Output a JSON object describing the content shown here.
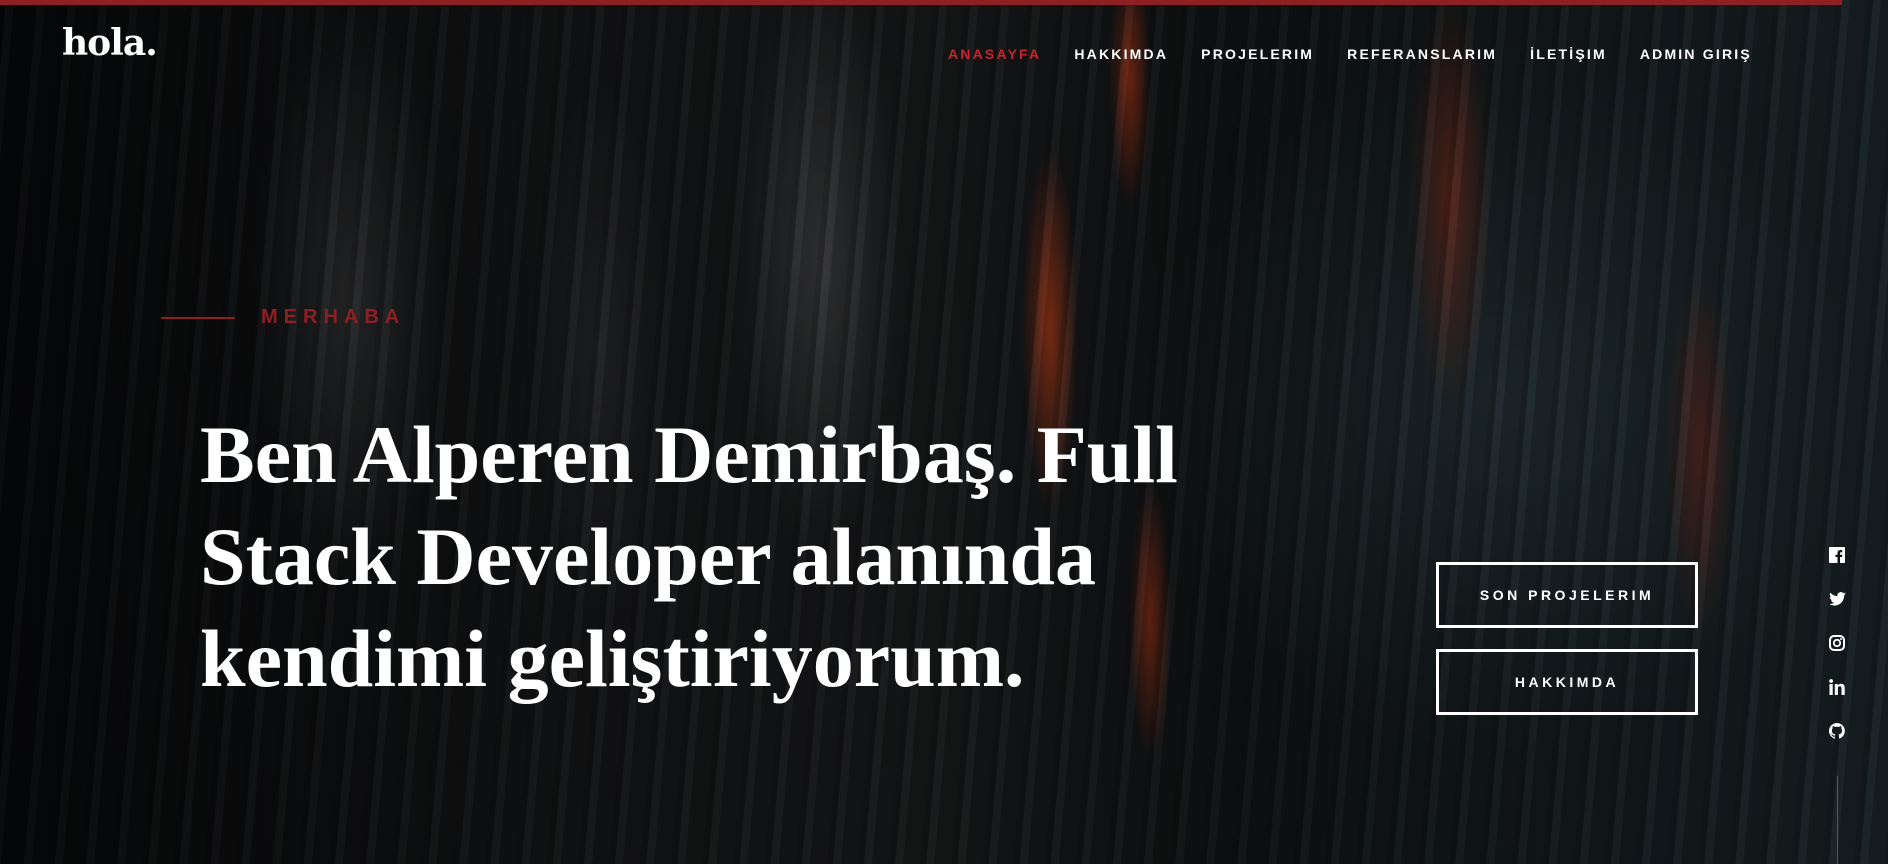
{
  "logo": "hola.",
  "nav": {
    "items": [
      {
        "label": "ANASAYFA",
        "active": true
      },
      {
        "label": "HAKKIMDA",
        "active": false
      },
      {
        "label": "PROJELERIM",
        "active": false
      },
      {
        "label": "REFERANSLARIM",
        "active": false
      },
      {
        "label": "İLETİŞIM",
        "active": false
      },
      {
        "label": "ADMIN GIRIŞ",
        "active": false
      }
    ]
  },
  "hero": {
    "intro": "MERHABA",
    "headline": "Ben Alperen Demirbaş. Full Stack Developer alanında kendimi geliştiriyorum.",
    "buttons": [
      "SON PROJELERIM",
      "HAKKIMDA"
    ]
  },
  "social": [
    "facebook-icon",
    "twitter-icon",
    "instagram-icon",
    "linkedin-icon",
    "github-icon"
  ],
  "colors": {
    "accent": "#8e1f22",
    "active_nav": "#c4262e"
  }
}
